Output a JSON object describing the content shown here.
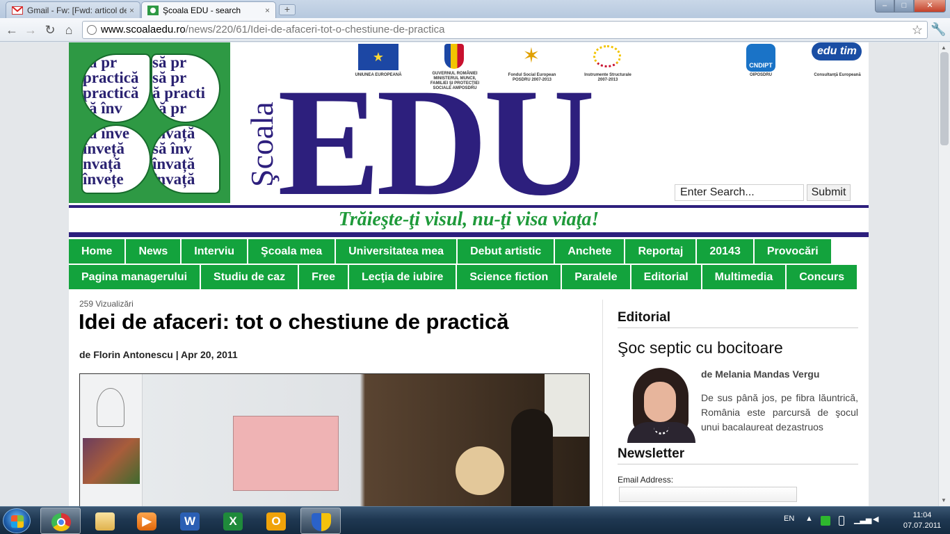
{
  "browser": {
    "tabs": [
      {
        "label": "Gmail - Fw: [Fwd: articol de",
        "icon": "gmail-icon"
      },
      {
        "label": "Şcoala EDU - search",
        "icon": "scoala-edu-favicon"
      }
    ],
    "close_glyph": "×",
    "newtab_glyph": "+",
    "window": {
      "minimize": "–",
      "maximize": "□",
      "close": "✕"
    },
    "nav": {
      "back": "←",
      "forward": "→",
      "reload": "↻",
      "home": "⌂",
      "star": "☆",
      "wrench": "🔧"
    },
    "url": {
      "host": "www.scoalaedu.ro",
      "path": "/news/220/61/Idei-de-afaceri-tot-o-chestiune-de-practica"
    }
  },
  "header": {
    "clover_words": {
      "l1": [
        "să pr",
        "practică",
        "practică",
        "să înv"
      ],
      "l2": [
        "să pr",
        "să pr",
        "ă practi",
        "să pr"
      ],
      "l3": [
        "să înve",
        "înveță",
        "nvață",
        "învețe"
      ],
      "l4": [
        "învață",
        "să înv",
        "învață",
        "învață"
      ]
    },
    "brand_small": "Şcoala",
    "brand_big": "EDU",
    "logos": [
      {
        "caption": "UNIUNEA EUROPEANĂ",
        "glyph": "★"
      },
      {
        "caption": "GUVERNUL ROMÂNIEI MINISTERUL MUNCII, FAMILIEI ŞI PROTECŢIEI SOCIALE AMPOSDRU"
      },
      {
        "caption": "Fondul Social European POSDRU 2007-2013",
        "glyph": "✶"
      },
      {
        "caption": "Instrumente Structurale 2007-2013"
      },
      {
        "name": "CNDIPT",
        "caption": "OIPOSDRU"
      },
      {
        "name": "edu tim",
        "caption": "Consultanţă Europeană"
      }
    ],
    "search_placeholder": "Enter Search...",
    "search_button": "Submit",
    "slogan": "Trăieşte-ţi visul, nu-ţi visa viaţa!"
  },
  "nav": {
    "row1": [
      "Home",
      "News",
      "Interviu",
      "Şcoala mea",
      "Universitatea mea",
      "Debut artistic",
      "Anchete",
      "Reportaj",
      "20143",
      "Provocări"
    ],
    "row2": [
      "Pagina managerului",
      "Studiu de caz",
      "Free",
      "Lecţia de iubire",
      "Science fiction",
      "Paralele",
      "Editorial",
      "Multimedia",
      "Concurs"
    ]
  },
  "article": {
    "views": "259 Vizualizări",
    "title": "Idei de afaceri: tot o chestiune de practică",
    "byline": "de Florin Antonescu | Apr 20, 2011"
  },
  "sidebar": {
    "editorial_heading": "Editorial",
    "editorial_title": "Şoc septic cu bocitoare",
    "editorial_author": "de Melania Mandas Vergu",
    "editorial_excerpt": "De sus până jos, pe fibra lăuntrică, România este parcursă de şocul unui bacalaureat dezastruos",
    "newsletter_heading": "Newsletter",
    "email_label": "Email Address:"
  },
  "taskbar": {
    "apps": [
      {
        "name": "chrome",
        "icon": "chrome-icon",
        "active": true
      },
      {
        "name": "explorer",
        "icon": "folder-icon"
      },
      {
        "name": "media",
        "icon": "media-player-icon"
      },
      {
        "name": "word",
        "icon": "word-icon",
        "glyph": "W"
      },
      {
        "name": "excel",
        "icon": "excel-icon",
        "glyph": "X"
      },
      {
        "name": "outlook",
        "icon": "outlook-icon",
        "glyph": "O"
      },
      {
        "name": "security",
        "icon": "shield-icon",
        "active": true
      }
    ],
    "language": "EN",
    "time": "11:04",
    "date": "07.07.2011"
  },
  "colors": {
    "nav_green": "#13a33d",
    "brand_indigo": "#2d1f7d",
    "slogan_green": "#1f9a3a",
    "clover_green": "#2e9944"
  }
}
